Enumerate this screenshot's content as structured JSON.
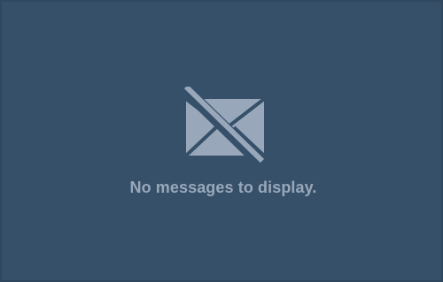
{
  "empty_state": {
    "icon": "mail-crossed-out-icon",
    "message": "No messages to display."
  },
  "colors": {
    "panel_background": "#365069",
    "panel_border": "#2f475f",
    "foreground": "#98a8ba"
  }
}
